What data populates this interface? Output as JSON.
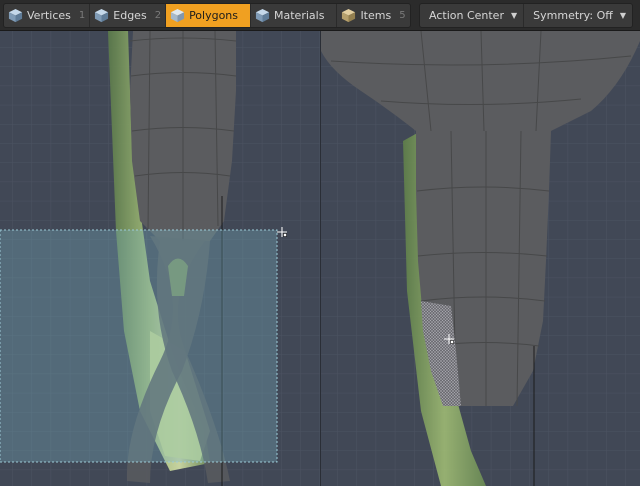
{
  "toolbar": {
    "modes": [
      {
        "label": "Vertices",
        "key": "1",
        "icon": "vertices-cube-icon",
        "active": false
      },
      {
        "label": "Edges",
        "key": "2",
        "icon": "edges-cube-icon",
        "active": false
      },
      {
        "label": "Polygons",
        "key": "",
        "icon": "polygons-cube-icon",
        "active": true
      },
      {
        "label": "Materials",
        "key": "",
        "icon": "materials-cube-icon",
        "active": false
      },
      {
        "label": "Items",
        "key": "5",
        "icon": "items-cube-icon",
        "active": false
      }
    ],
    "action_center": {
      "label": "Action Center"
    },
    "symmetry": {
      "label": "Symmetry: Off"
    }
  },
  "colors": {
    "active_mode": "#f0a021",
    "viewport_bg": "#414856",
    "mesh": "#5a5a5c",
    "selection": "#7ab3c4"
  }
}
